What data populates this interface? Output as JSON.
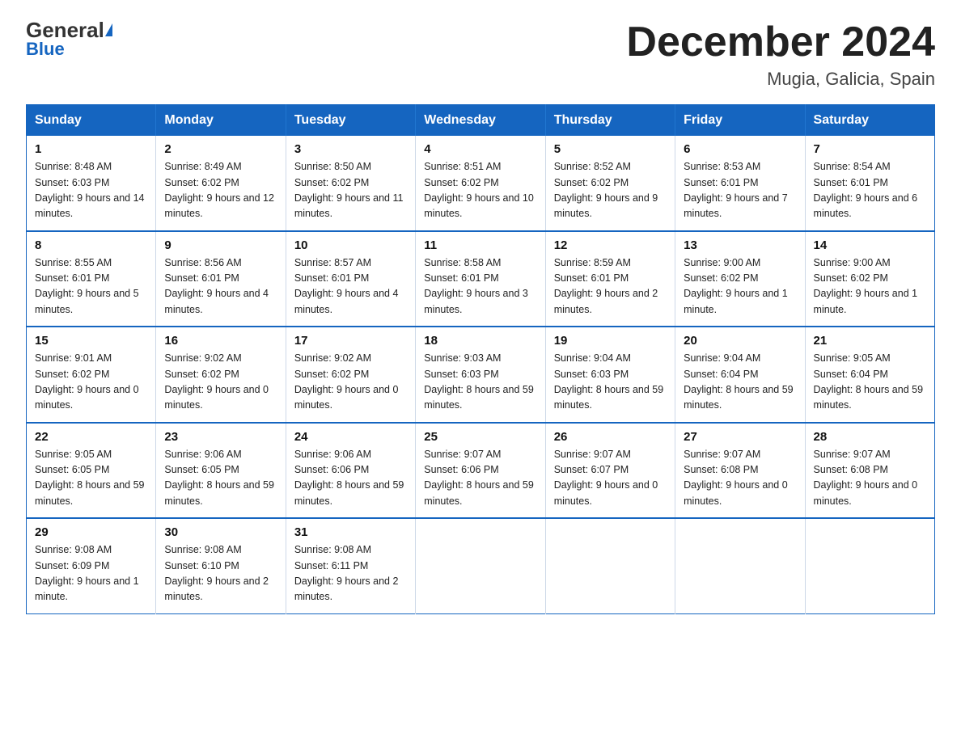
{
  "header": {
    "logo_general": "General",
    "logo_blue": "Blue",
    "month_title": "December 2024",
    "location": "Mugia, Galicia, Spain"
  },
  "days_of_week": [
    "Sunday",
    "Monday",
    "Tuesday",
    "Wednesday",
    "Thursday",
    "Friday",
    "Saturday"
  ],
  "weeks": [
    [
      {
        "num": "1",
        "sunrise": "8:48 AM",
        "sunset": "6:03 PM",
        "daylight": "9 hours and 14 minutes."
      },
      {
        "num": "2",
        "sunrise": "8:49 AM",
        "sunset": "6:02 PM",
        "daylight": "9 hours and 12 minutes."
      },
      {
        "num": "3",
        "sunrise": "8:50 AM",
        "sunset": "6:02 PM",
        "daylight": "9 hours and 11 minutes."
      },
      {
        "num": "4",
        "sunrise": "8:51 AM",
        "sunset": "6:02 PM",
        "daylight": "9 hours and 10 minutes."
      },
      {
        "num": "5",
        "sunrise": "8:52 AM",
        "sunset": "6:02 PM",
        "daylight": "9 hours and 9 minutes."
      },
      {
        "num": "6",
        "sunrise": "8:53 AM",
        "sunset": "6:01 PM",
        "daylight": "9 hours and 7 minutes."
      },
      {
        "num": "7",
        "sunrise": "8:54 AM",
        "sunset": "6:01 PM",
        "daylight": "9 hours and 6 minutes."
      }
    ],
    [
      {
        "num": "8",
        "sunrise": "8:55 AM",
        "sunset": "6:01 PM",
        "daylight": "9 hours and 5 minutes."
      },
      {
        "num": "9",
        "sunrise": "8:56 AM",
        "sunset": "6:01 PM",
        "daylight": "9 hours and 4 minutes."
      },
      {
        "num": "10",
        "sunrise": "8:57 AM",
        "sunset": "6:01 PM",
        "daylight": "9 hours and 4 minutes."
      },
      {
        "num": "11",
        "sunrise": "8:58 AM",
        "sunset": "6:01 PM",
        "daylight": "9 hours and 3 minutes."
      },
      {
        "num": "12",
        "sunrise": "8:59 AM",
        "sunset": "6:01 PM",
        "daylight": "9 hours and 2 minutes."
      },
      {
        "num": "13",
        "sunrise": "9:00 AM",
        "sunset": "6:02 PM",
        "daylight": "9 hours and 1 minute."
      },
      {
        "num": "14",
        "sunrise": "9:00 AM",
        "sunset": "6:02 PM",
        "daylight": "9 hours and 1 minute."
      }
    ],
    [
      {
        "num": "15",
        "sunrise": "9:01 AM",
        "sunset": "6:02 PM",
        "daylight": "9 hours and 0 minutes."
      },
      {
        "num": "16",
        "sunrise": "9:02 AM",
        "sunset": "6:02 PM",
        "daylight": "9 hours and 0 minutes."
      },
      {
        "num": "17",
        "sunrise": "9:02 AM",
        "sunset": "6:02 PM",
        "daylight": "9 hours and 0 minutes."
      },
      {
        "num": "18",
        "sunrise": "9:03 AM",
        "sunset": "6:03 PM",
        "daylight": "8 hours and 59 minutes."
      },
      {
        "num": "19",
        "sunrise": "9:04 AM",
        "sunset": "6:03 PM",
        "daylight": "8 hours and 59 minutes."
      },
      {
        "num": "20",
        "sunrise": "9:04 AM",
        "sunset": "6:04 PM",
        "daylight": "8 hours and 59 minutes."
      },
      {
        "num": "21",
        "sunrise": "9:05 AM",
        "sunset": "6:04 PM",
        "daylight": "8 hours and 59 minutes."
      }
    ],
    [
      {
        "num": "22",
        "sunrise": "9:05 AM",
        "sunset": "6:05 PM",
        "daylight": "8 hours and 59 minutes."
      },
      {
        "num": "23",
        "sunrise": "9:06 AM",
        "sunset": "6:05 PM",
        "daylight": "8 hours and 59 minutes."
      },
      {
        "num": "24",
        "sunrise": "9:06 AM",
        "sunset": "6:06 PM",
        "daylight": "8 hours and 59 minutes."
      },
      {
        "num": "25",
        "sunrise": "9:07 AM",
        "sunset": "6:06 PM",
        "daylight": "8 hours and 59 minutes."
      },
      {
        "num": "26",
        "sunrise": "9:07 AM",
        "sunset": "6:07 PM",
        "daylight": "9 hours and 0 minutes."
      },
      {
        "num": "27",
        "sunrise": "9:07 AM",
        "sunset": "6:08 PM",
        "daylight": "9 hours and 0 minutes."
      },
      {
        "num": "28",
        "sunrise": "9:07 AM",
        "sunset": "6:08 PM",
        "daylight": "9 hours and 0 minutes."
      }
    ],
    [
      {
        "num": "29",
        "sunrise": "9:08 AM",
        "sunset": "6:09 PM",
        "daylight": "9 hours and 1 minute."
      },
      {
        "num": "30",
        "sunrise": "9:08 AM",
        "sunset": "6:10 PM",
        "daylight": "9 hours and 2 minutes."
      },
      {
        "num": "31",
        "sunrise": "9:08 AM",
        "sunset": "6:11 PM",
        "daylight": "9 hours and 2 minutes."
      },
      null,
      null,
      null,
      null
    ]
  ],
  "labels": {
    "sunrise": "Sunrise:",
    "sunset": "Sunset:",
    "daylight": "Daylight:"
  }
}
